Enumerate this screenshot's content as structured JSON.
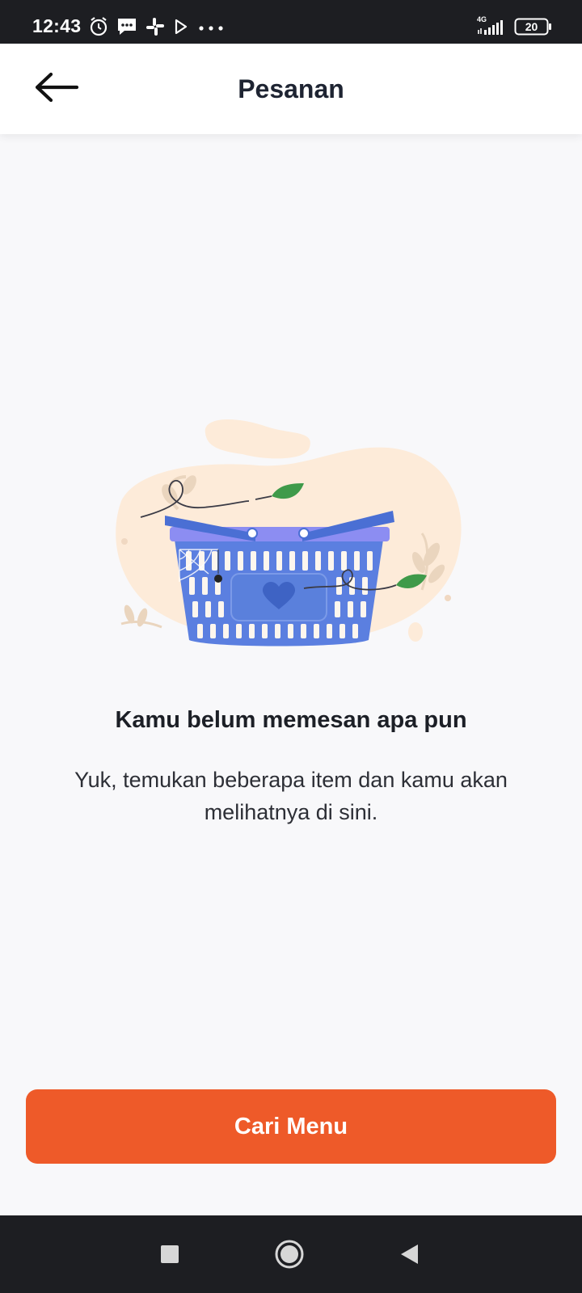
{
  "status_bar": {
    "time": "12:43",
    "network": "4G",
    "battery": "20",
    "icons": [
      "alarm-icon",
      "message-icon",
      "slack-icon",
      "play-store-icon",
      "more-dots-icon",
      "signal-icon",
      "battery-icon"
    ]
  },
  "header": {
    "title": "Pesanan",
    "back_icon": "arrow-left-icon"
  },
  "empty_state": {
    "illustration": "empty-basket-illustration",
    "title": "Kamu belum memesan apa pun",
    "description": "Yuk, temukan beberapa item dan kamu akan melihatnya di sini."
  },
  "cta": {
    "label": "Cari Menu"
  },
  "nav_bar": {
    "icons": [
      "recents-square-icon",
      "home-circle-icon",
      "back-triangle-icon"
    ]
  },
  "colors": {
    "accent": "#ee5a29",
    "basket_blue": "#5b7fe0",
    "basket_rim": "#8c8df2",
    "blob_peach": "#fdebd9",
    "leaf_green": "#3f9a4a",
    "background": "#f8f8fa"
  }
}
